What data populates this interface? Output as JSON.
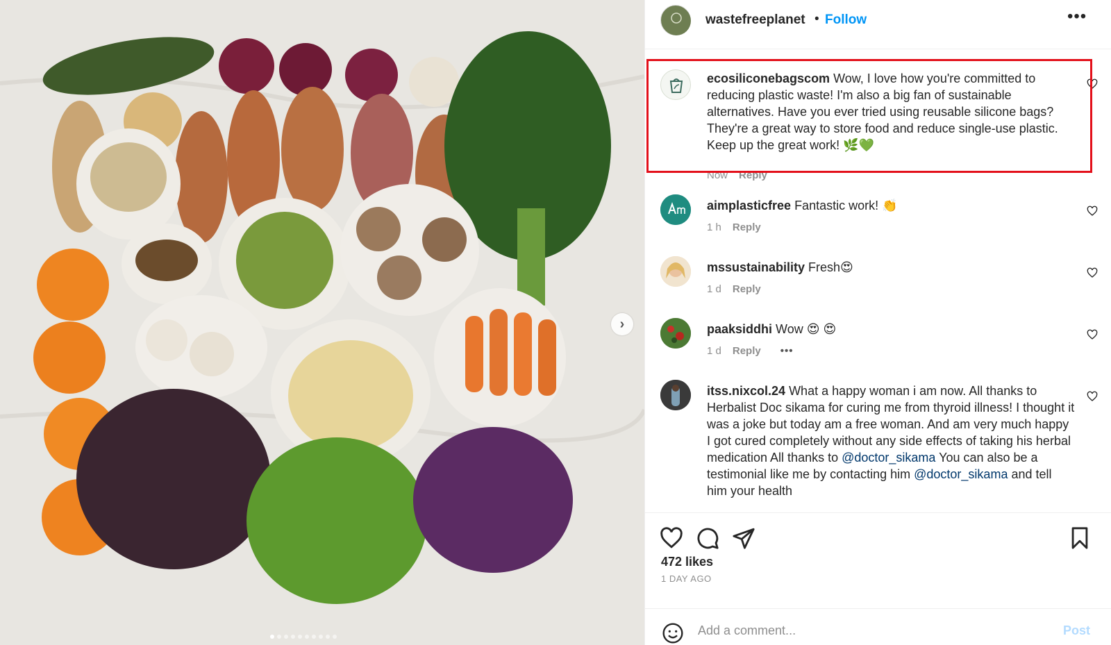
{
  "post": {
    "username": "wastefreeplanet",
    "separator": "•",
    "follow_label": "Follow",
    "more_label": "•••",
    "next_label": "›",
    "carousel_dots": 10,
    "carousel_active": 0
  },
  "comments": [
    {
      "username": "ecosiliconebagscom",
      "text": " Wow, I love how you're committed to reducing plastic waste! I'm also a big fan of sustainable alternatives. Have you ever tried using reusable silicone bags? They're a great way to store food and reduce single-use plastic. Keep up the great work! 🌿💚",
      "time": "Now",
      "reply_label": "Reply",
      "highlighted": true
    },
    {
      "username": "aimplasticfree",
      "text": " Fantastic work! 👏",
      "time": "1 h",
      "reply_label": "Reply"
    },
    {
      "username": "mssustainability",
      "text": " Fresh😍",
      "time": "1 d",
      "reply_label": "Reply"
    },
    {
      "username": "paaksiddhi",
      "text": " Wow 😍 😍",
      "time": "1 d",
      "reply_label": "Reply",
      "more_label": "•••"
    },
    {
      "username": "itss.nixcol.24",
      "text_parts": [
        " What a happy woman i am now. All thanks to Herbalist Doc sikama for curing me from thyroid illness! I thought it was a joke but today am a free woman. And am very much happy I got cured completely without any side effects of taking his herbal medication All thanks to ",
        "@doctor_sikama",
        " You can also be a testimonial like me by contacting him ",
        "@doctor_sikama",
        " and tell him your health"
      ]
    }
  ],
  "footer": {
    "likes": "472 likes",
    "date": "1 DAY AGO",
    "comment_placeholder": "Add a comment...",
    "post_label": "Post"
  },
  "colors": {
    "accent": "#0095f6",
    "highlight_border": "#e3101a",
    "mention": "#00376b"
  },
  "icons": [
    "heart-icon",
    "comment-icon",
    "share-icon",
    "bookmark-icon",
    "emoji-icon",
    "chevron-right-icon"
  ]
}
